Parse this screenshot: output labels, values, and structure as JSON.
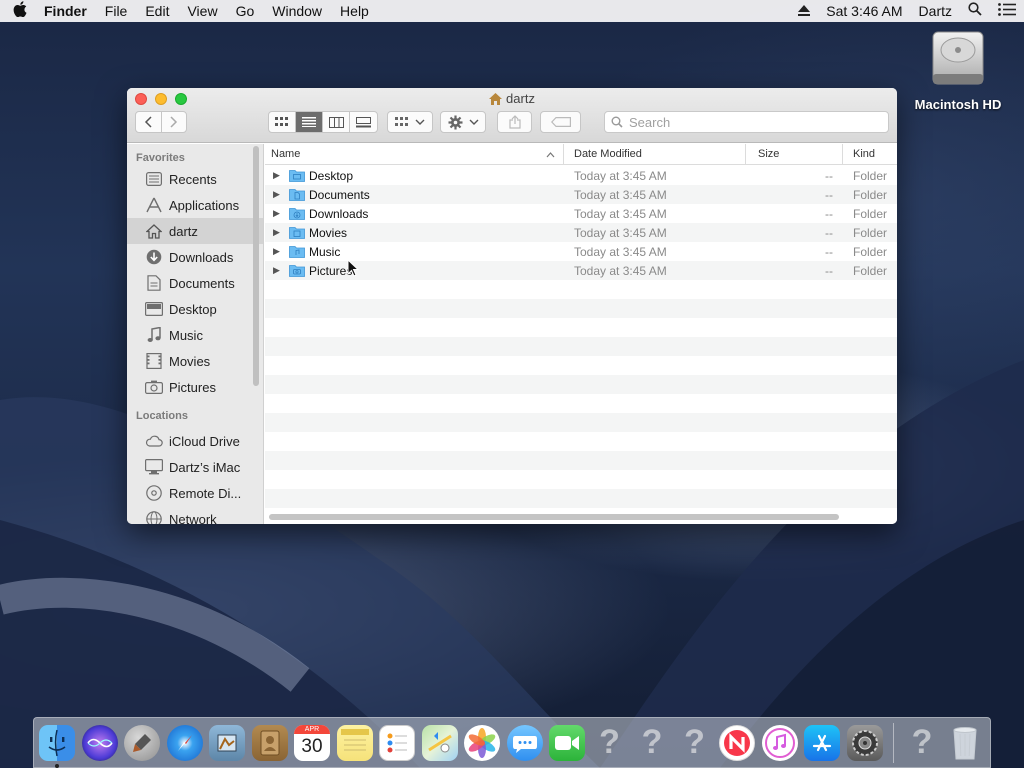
{
  "menubar": {
    "app": "Finder",
    "items": [
      "File",
      "Edit",
      "View",
      "Go",
      "Window",
      "Help"
    ],
    "clock": "Sat 3:46 AM",
    "user": "Dartz"
  },
  "desktop": {
    "drive_label": "Macintosh HD"
  },
  "window": {
    "title": "dartz",
    "search_placeholder": "Search"
  },
  "sidebar": {
    "favorites_header": "Favorites",
    "favorites": [
      {
        "label": "Recents",
        "icon": "recents-icon"
      },
      {
        "label": "Applications",
        "icon": "applications-icon"
      },
      {
        "label": "dartz",
        "icon": "home-icon",
        "selected": true
      },
      {
        "label": "Downloads",
        "icon": "downloads-icon"
      },
      {
        "label": "Documents",
        "icon": "documents-icon"
      },
      {
        "label": "Desktop",
        "icon": "desktop-icon"
      },
      {
        "label": "Music",
        "icon": "music-icon"
      },
      {
        "label": "Movies",
        "icon": "movies-icon"
      },
      {
        "label": "Pictures",
        "icon": "pictures-icon"
      }
    ],
    "locations_header": "Locations",
    "locations": [
      {
        "label": "iCloud Drive",
        "icon": "icloud-icon"
      },
      {
        "label": "Dartz’s iMac",
        "icon": "imac-icon"
      },
      {
        "label": "Remote Di...",
        "icon": "disc-icon"
      },
      {
        "label": "Network",
        "icon": "network-icon"
      }
    ]
  },
  "columns": {
    "name": "Name",
    "date": "Date Modified",
    "size": "Size",
    "kind": "Kind"
  },
  "files": [
    {
      "name": "Desktop",
      "date": "Today at 3:45 AM",
      "size": "--",
      "kind": "Folder"
    },
    {
      "name": "Documents",
      "date": "Today at 3:45 AM",
      "size": "--",
      "kind": "Folder"
    },
    {
      "name": "Downloads",
      "date": "Today at 3:45 AM",
      "size": "--",
      "kind": "Folder"
    },
    {
      "name": "Movies",
      "date": "Today at 3:45 AM",
      "size": "--",
      "kind": "Folder"
    },
    {
      "name": "Music",
      "date": "Today at 3:45 AM",
      "size": "--",
      "kind": "Folder"
    },
    {
      "name": "Pictures",
      "date": "Today at 3:45 AM",
      "size": "--",
      "kind": "Folder"
    }
  ],
  "dock": {
    "calendar_month": "APR",
    "calendar_day": "30"
  },
  "colors": {
    "accent_folder": "#4aa8e8",
    "close": "#fc5f57",
    "minimize": "#fdbc2e",
    "maximize": "#28c840"
  }
}
